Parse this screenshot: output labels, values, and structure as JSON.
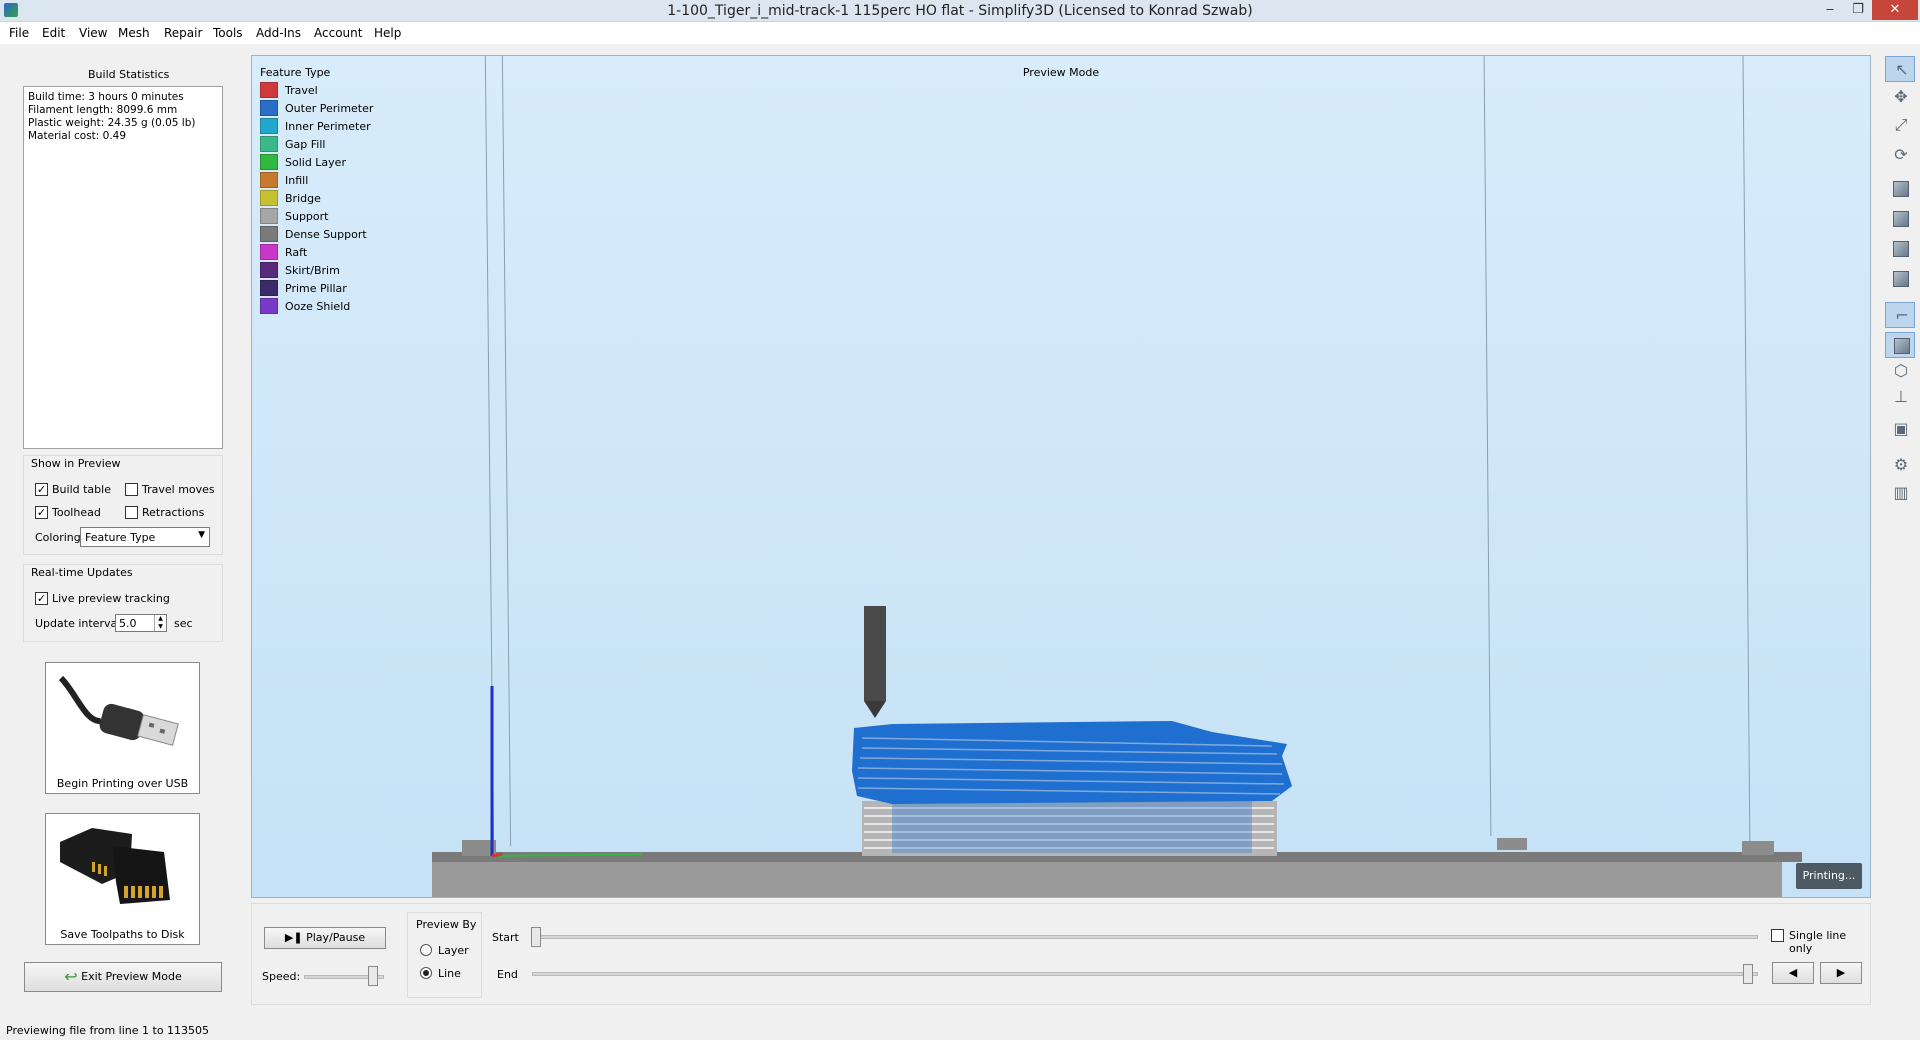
{
  "window": {
    "title": "1-100_Tiger_i_mid-track-1 115perc HO flat - Simplify3D (Licensed to Konrad Szwab)",
    "minimize": "‒",
    "restore": "❐",
    "close": "✕"
  },
  "menu": [
    "File",
    "Edit",
    "View",
    "Mesh",
    "Repair",
    "Tools",
    "Add-Ins",
    "Account",
    "Help"
  ],
  "build_stats": {
    "heading": "Build Statistics",
    "lines": [
      "Build time: 3 hours 0 minutes",
      "Filament length: 8099.6 mm",
      "Plastic weight: 24.35 g (0.05 lb)",
      "Material cost: 0.49"
    ]
  },
  "show_in_preview": {
    "heading": "Show in Preview",
    "build_table": {
      "label": "Build table",
      "checked": true
    },
    "travel_moves": {
      "label": "Travel moves",
      "checked": false
    },
    "toolhead": {
      "label": "Toolhead",
      "checked": true
    },
    "retractions": {
      "label": "Retractions",
      "checked": false
    },
    "coloring_label": "Coloring",
    "coloring_value": "Feature Type"
  },
  "realtime": {
    "heading": "Real-time Updates",
    "live_preview": {
      "label": "Live preview tracking",
      "checked": true
    },
    "interval_label": "Update interval",
    "interval_value": "5.0",
    "interval_unit": "sec"
  },
  "usb_button": {
    "label": "Begin Printing over USB",
    "icon": "usb-cable-icon"
  },
  "disk_button": {
    "label": "Save Toolpaths to Disk",
    "icon": "sd-card-icon"
  },
  "exit_preview": {
    "label": "Exit Preview Mode",
    "icon": "back-arrow-icon"
  },
  "viewport": {
    "mode_title": "Preview Mode",
    "legend_title": "Feature Type",
    "legend": [
      {
        "label": "Travel",
        "color": "#d13a3a"
      },
      {
        "label": "Outer Perimeter",
        "color": "#2a6ec8"
      },
      {
        "label": "Inner Perimeter",
        "color": "#22a8cc"
      },
      {
        "label": "Gap Fill",
        "color": "#3cb88a"
      },
      {
        "label": "Solid Layer",
        "color": "#30b840"
      },
      {
        "label": "Infill",
        "color": "#c77a2f"
      },
      {
        "label": "Bridge",
        "color": "#c8c030"
      },
      {
        "label": "Support",
        "color": "#a6a6a6"
      },
      {
        "label": "Dense Support",
        "color": "#7a7a7a"
      },
      {
        "label": "Raft",
        "color": "#c838c8"
      },
      {
        "label": "Skirt/Brim",
        "color": "#5a2a7a"
      },
      {
        "label": "Prime Pillar",
        "color": "#3a2a6a"
      },
      {
        "label": "Ooze Shield",
        "color": "#7a3ac8"
      }
    ],
    "status_badge": "Printing..."
  },
  "right_toolbar": [
    {
      "name": "select-tool",
      "glyph": "↖",
      "active": true
    },
    {
      "name": "move-tool",
      "glyph": "✥",
      "active": false
    },
    {
      "name": "scale-tool",
      "glyph": "⤢",
      "active": false
    },
    {
      "name": "rotate-tool",
      "glyph": "⟳",
      "active": false
    },
    {
      "name": "view-front",
      "glyph": "cube",
      "active": false
    },
    {
      "name": "view-top",
      "glyph": "cube",
      "active": false
    },
    {
      "name": "view-side",
      "glyph": "cube",
      "active": false
    },
    {
      "name": "view-iso",
      "glyph": "cube",
      "active": false
    },
    {
      "name": "axes-toggle",
      "glyph": "⌐",
      "active": true
    },
    {
      "name": "solid-view",
      "glyph": "cube",
      "active": true
    },
    {
      "name": "wireframe-view",
      "glyph": "⬡",
      "active": false
    },
    {
      "name": "normals-view",
      "glyph": "⊥",
      "active": false
    },
    {
      "name": "cross-section",
      "glyph": "▣",
      "active": false
    },
    {
      "name": "settings",
      "glyph": "⚙",
      "active": false
    },
    {
      "name": "support-view",
      "glyph": "▥",
      "active": false
    }
  ],
  "controls": {
    "play_pause": "Play/Pause",
    "speed_label": "Speed:",
    "preview_by": "Preview By",
    "layer": "Layer",
    "line": "Line",
    "line_selected": true,
    "start_label": "Start",
    "end_label": "End",
    "single_line": "Single line only",
    "prev": "◀",
    "next": "▶"
  },
  "status": "Previewing file from line 1 to 113505"
}
